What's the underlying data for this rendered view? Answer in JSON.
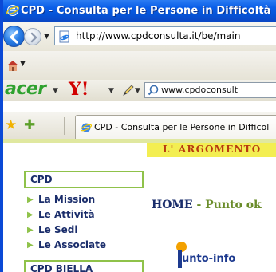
{
  "window": {
    "title": "CPD - Consulta per le Persone in Difficoltà"
  },
  "navigation": {
    "url": "http://www.cpdconsulta.it/be/main"
  },
  "acer_toolbar": {
    "acer_logo": "acer",
    "yahoo_logo": "Y!",
    "search_text": "www.cpdoconsult"
  },
  "tabs": {
    "active_label": "CPD - Consulta per le Persone in Difficol"
  },
  "page": {
    "banner": "L' ARGOMENTO",
    "sidebar_heading": "CPD",
    "menu": [
      {
        "label": "La Mission"
      },
      {
        "label": "Le Attività"
      },
      {
        "label": "Le Sedi"
      },
      {
        "label": "Le Associate"
      }
    ],
    "sidebar_heading_2": "CPD BIELLA",
    "headline_home": "HOME",
    "headline_dash": " - ",
    "headline_rest": "Punto ok",
    "logo_text": "unto-info"
  },
  "colors": {
    "title_bar": "#0653d6",
    "accent_green": "#8fc24a",
    "banner_yellow": "#f3ee52",
    "navy_text": "#1a2d6b"
  }
}
